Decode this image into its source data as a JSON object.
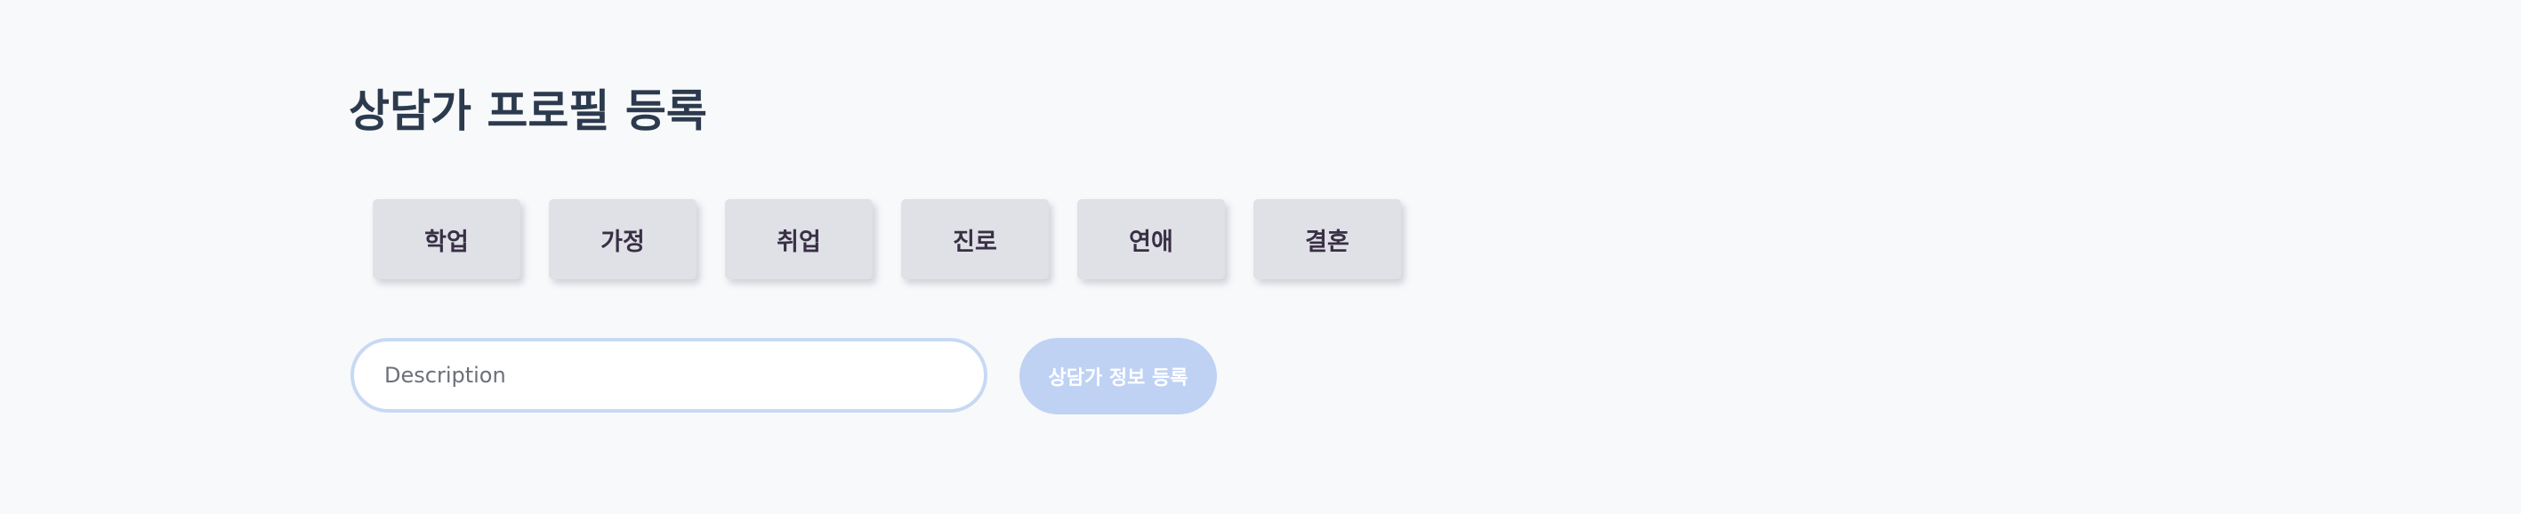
{
  "page": {
    "title": "상담가 프로필 등록"
  },
  "categories": [
    {
      "label": "학업"
    },
    {
      "label": "가정"
    },
    {
      "label": "취업"
    },
    {
      "label": "진로"
    },
    {
      "label": "연애"
    },
    {
      "label": "결혼"
    }
  ],
  "description": {
    "value": "",
    "placeholder": "Description"
  },
  "submit": {
    "label": "상담가 정보 등록"
  },
  "colors": {
    "background": "#f8f9fb",
    "title": "#2c3a4d",
    "category_bg": "#dfe1e7",
    "category_text": "#3a2f45",
    "input_border": "#c7d9f3",
    "button_bg": "#bfd2f4",
    "button_text": "#ffffff"
  }
}
